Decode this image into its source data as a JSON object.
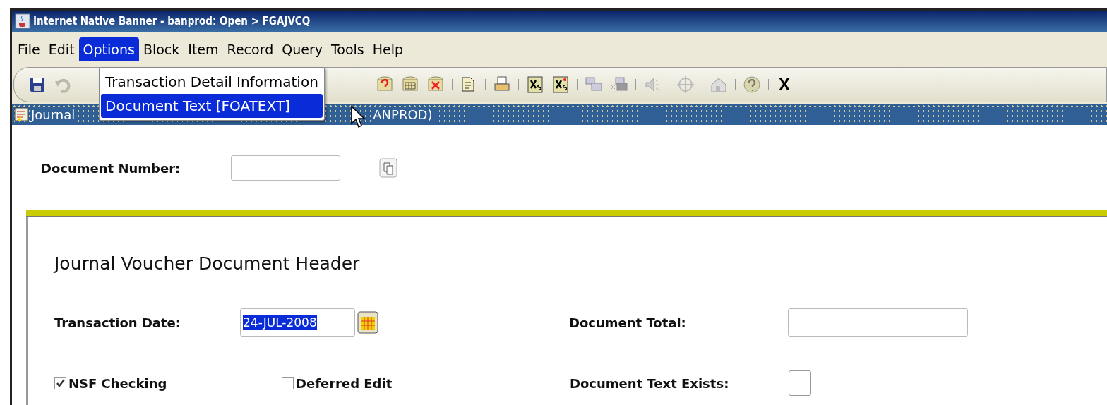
{
  "window": {
    "title": "Internet Native Banner - banprod:  Open > FGAJVCQ"
  },
  "menu": [
    {
      "label": "File",
      "selected": false
    },
    {
      "label": "Edit",
      "selected": false
    },
    {
      "label": "Options",
      "selected": true
    },
    {
      "label": "Block",
      "selected": false
    },
    {
      "label": "Item",
      "selected": false
    },
    {
      "label": "Record",
      "selected": false
    },
    {
      "label": "Query",
      "selected": false
    },
    {
      "label": "Tools",
      "selected": false
    },
    {
      "label": "Help",
      "selected": false
    }
  ],
  "dropdown": [
    {
      "label": "Transaction Detail Information",
      "selected": false
    },
    {
      "label": "Document Text [FOATEXT]",
      "selected": true
    }
  ],
  "toolbar": {
    "exit_label": "X"
  },
  "form_title": {
    "start": "Journal",
    "end": "ANPROD)"
  },
  "key_block": {
    "document_number": {
      "label": "Document Number:"
    }
  },
  "header": {
    "title": "Journal Voucher Document Header",
    "transaction_date": {
      "label": "Transaction Date:",
      "value": "24-JUL-2008",
      "highlighted": true
    },
    "document_total": {
      "label": "Document Total:"
    },
    "checkboxes": [
      {
        "label": "NSF Checking",
        "checked": true
      },
      {
        "label": "Deferred Edit",
        "checked": false
      }
    ],
    "document_text_exists": {
      "label": "Document Text Exists:",
      "checked": false
    }
  }
}
